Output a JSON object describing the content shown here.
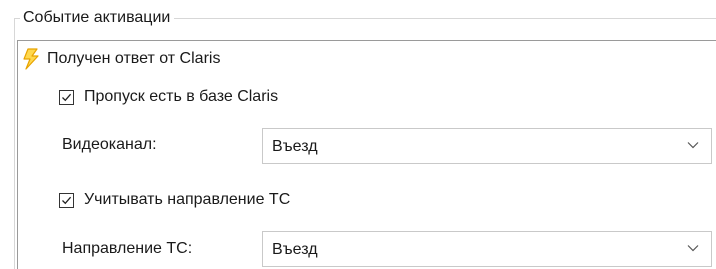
{
  "group": {
    "title": "Событие активации"
  },
  "event": {
    "icon": "lightning-bolt-icon",
    "label": "Получен ответ от Claris"
  },
  "pass_in_db": {
    "label": "Пропуск есть в базе Claris",
    "checked": true
  },
  "video_channel": {
    "label": "Видеоканал:",
    "value": "Въезд"
  },
  "consider_direction": {
    "label": "Учитывать направление ТС",
    "checked": true
  },
  "vehicle_direction": {
    "label": "Направление ТС:",
    "value": "Въезд"
  },
  "colors": {
    "bolt_fill": "#ffd84d",
    "bolt_stroke": "#e8a300"
  }
}
